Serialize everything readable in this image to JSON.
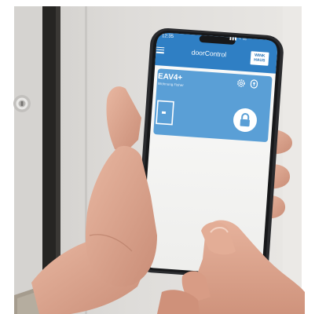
{
  "status_bar": {
    "time": "12:35",
    "indicators": "▮▮▮ ◔ ▭"
  },
  "app_bar": {
    "title": "doorControl",
    "menu_icon": "hamburger-menu-icon",
    "logo_text": "WINK HAUS"
  },
  "device_card": {
    "name": "EAV4+",
    "subtitle": "Wohnung Fisher",
    "settings_icon": "gear-icon",
    "key_icon": "lock-icon",
    "door_icon": "door-icon",
    "action_icon": "padlock-icon"
  },
  "colors": {
    "app_bar_blue": "#2f7fc4",
    "card_blue": "#5a9fd6",
    "screen_white": "#f4f4f2",
    "skin": "#dca58e",
    "wall": "#e4e2df",
    "frame_dark": "#262523"
  }
}
